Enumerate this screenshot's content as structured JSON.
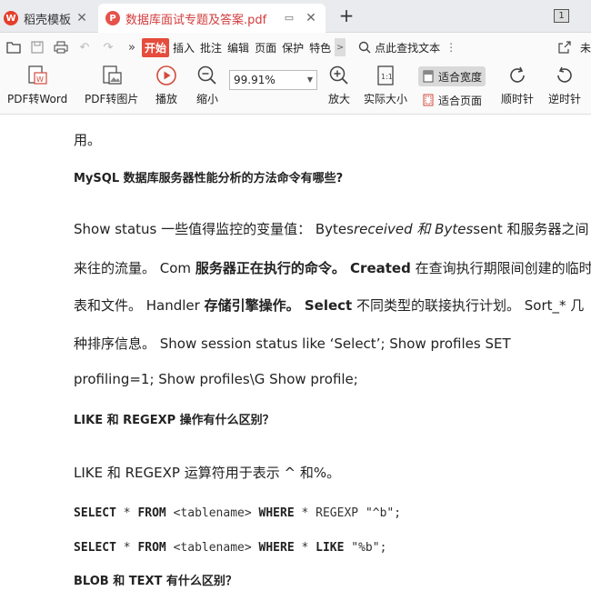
{
  "tabs": {
    "home_label": "稻壳模板",
    "doc_label": "数据库面试专题及答案.pdf",
    "new_tab": "+",
    "count": "1"
  },
  "menu": {
    "items": [
      "开始",
      "插入",
      "批注",
      "编辑",
      "页面",
      "保护",
      "特色"
    ],
    "more": ">",
    "search_label": "点此查找文本",
    "right_label": "未"
  },
  "toolbar": {
    "pdf_to_word": "PDF转Word",
    "pdf_to_image": "PDF转图片",
    "play": "播放",
    "zoom_out": "缩小",
    "zoom_value": "99.91%",
    "zoom_in": "放大",
    "actual_size": "实际大小",
    "fit_width": "适合宽度",
    "fit_page": "适合页面",
    "rotate_cw": "顺时针",
    "rotate_ccw": "逆时针"
  },
  "document": {
    "l1": "用。",
    "h1": "MySQL 数据库服务器性能分析的方法命令有哪些?",
    "l2a": "Show status 一些值得监控的变量值： Bytes",
    "l2b": "received 和 Bytes",
    "l2c": "sent 和服务器之间",
    "l3a": "来往的流量。 Com ",
    "l3b": "服务器正在执行的命令。",
    "l3c": " Created",
    "l3d": " 在查询执行期限间创建的临时",
    "l4a": "表和文件。 Handler ",
    "l4b": "存储引擎操作。",
    "l4c": " Select",
    "l4d": " 不同类型的联接执行计划。 Sort_* 几",
    "l5": "种排序信息。 Show session status like ‘Select’; Show profiles SET",
    "l6": "profiling=1; Show profiles\\G Show profile;",
    "h2": "LIKE 和 REGEXP 操作有什么区别？",
    "l7": "LIKE 和 REGEXP 运算符用于表示 ^ 和%。",
    "c1": {
      "a": "SELECT",
      "b": " * ",
      "c": "FROM",
      "d": " <tablename> ",
      "e": "WHERE",
      "f": " * REGEXP ",
      "g": "\"^b\"",
      "h": ";"
    },
    "c2": {
      "a": "SELECT",
      "b": " * ",
      "c": "FROM",
      "d": " <tablename> ",
      "e": "WHERE",
      "f": " * ",
      "g": "LIKE",
      "h": " ",
      "i": "\"%b\"",
      "j": ";"
    },
    "h3": "BLOB 和 TEXT 有什么区别？"
  }
}
